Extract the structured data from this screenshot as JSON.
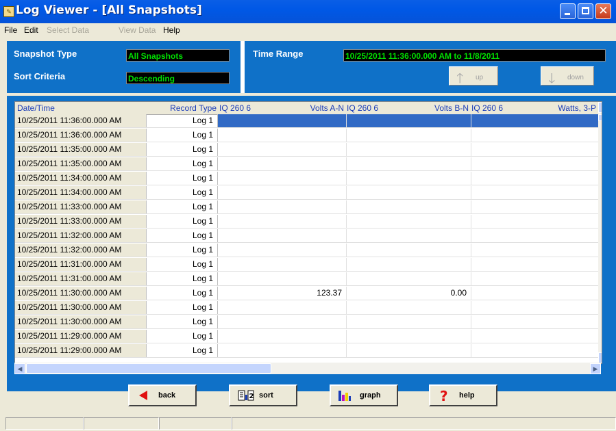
{
  "window": {
    "title": "Log Viewer - [All Snapshots]",
    "app_icon": "log-viewer-icon"
  },
  "menu": [
    {
      "label": "File",
      "enabled": true
    },
    {
      "label": "Edit",
      "enabled": true
    },
    {
      "label": "Select Data",
      "enabled": false
    },
    {
      "label": "View Data",
      "enabled": false
    },
    {
      "label": "Help",
      "enabled": true
    }
  ],
  "info": {
    "snapshot_type_label": "Snapshot Type",
    "snapshot_type_value": "All Snapshots",
    "sort_criteria_label": "Sort Criteria",
    "sort_criteria_value": "Descending",
    "time_range_label": "Time Range",
    "time_range_value": "10/25/2011 11:36:00.000 AM to 11/8/2011",
    "up_label": "up",
    "down_label": "down"
  },
  "grid": {
    "headers": {
      "date": "Date/Time",
      "record": "Record Type",
      "c1_device": "IQ 260 6",
      "c1_param": "Volts A-N",
      "c2_device": "IQ 260 6",
      "c2_param": "Volts B-N",
      "c3_device": "IQ 260 6",
      "c3_param": "Watts, 3-P"
    },
    "rows": [
      {
        "date": "10/25/2011 11:36:00.000 AM",
        "record": "Log 1",
        "v1": "",
        "v2": "",
        "v3": "",
        "selected": true
      },
      {
        "date": "10/25/2011 11:36:00.000 AM",
        "record": "Log 1",
        "v1": "",
        "v2": "",
        "v3": ""
      },
      {
        "date": "10/25/2011 11:35:00.000 AM",
        "record": "Log 1",
        "v1": "",
        "v2": "",
        "v3": ""
      },
      {
        "date": "10/25/2011 11:35:00.000 AM",
        "record": "Log 1",
        "v1": "",
        "v2": "",
        "v3": ""
      },
      {
        "date": "10/25/2011 11:34:00.000 AM",
        "record": "Log 1",
        "v1": "",
        "v2": "",
        "v3": ""
      },
      {
        "date": "10/25/2011 11:34:00.000 AM",
        "record": "Log 1",
        "v1": "",
        "v2": "",
        "v3": ""
      },
      {
        "date": "10/25/2011 11:33:00.000 AM",
        "record": "Log 1",
        "v1": "",
        "v2": "",
        "v3": ""
      },
      {
        "date": "10/25/2011 11:33:00.000 AM",
        "record": "Log 1",
        "v1": "",
        "v2": "",
        "v3": ""
      },
      {
        "date": "10/25/2011 11:32:00.000 AM",
        "record": "Log 1",
        "v1": "",
        "v2": "",
        "v3": ""
      },
      {
        "date": "10/25/2011 11:32:00.000 AM",
        "record": "Log 1",
        "v1": "",
        "v2": "",
        "v3": ""
      },
      {
        "date": "10/25/2011 11:31:00.000 AM",
        "record": "Log 1",
        "v1": "",
        "v2": "",
        "v3": ""
      },
      {
        "date": "10/25/2011 11:31:00.000 AM",
        "record": "Log 1",
        "v1": "",
        "v2": "",
        "v3": ""
      },
      {
        "date": "10/25/2011 11:30:00.000 AM",
        "record": "Log 1",
        "v1": "123.37",
        "v2": "0.00",
        "v3": ""
      },
      {
        "date": "10/25/2011 11:30:00.000 AM",
        "record": "Log 1",
        "v1": "",
        "v2": "",
        "v3": ""
      },
      {
        "date": "10/25/2011 11:30:00.000 AM",
        "record": "Log 1",
        "v1": "",
        "v2": "",
        "v3": ""
      },
      {
        "date": "10/25/2011 11:29:00.000 AM",
        "record": "Log 1",
        "v1": "",
        "v2": "",
        "v3": ""
      },
      {
        "date": "10/25/2011 11:29:00.000 AM",
        "record": "Log 1",
        "v1": "",
        "v2": "",
        "v3": ""
      }
    ]
  },
  "actions": [
    {
      "label": "back",
      "icon": "back-arrow-icon"
    },
    {
      "label": "sort",
      "icon": "sort-icon"
    },
    {
      "label": "graph",
      "icon": "graph-icon"
    },
    {
      "label": "help",
      "icon": "help-icon"
    }
  ],
  "colors": {
    "panel_blue": "#0f71c8",
    "title_blue": "#0058e6",
    "value_green": "#00e000",
    "selection_blue": "#316ac5",
    "header_text": "#1a3cb8"
  }
}
